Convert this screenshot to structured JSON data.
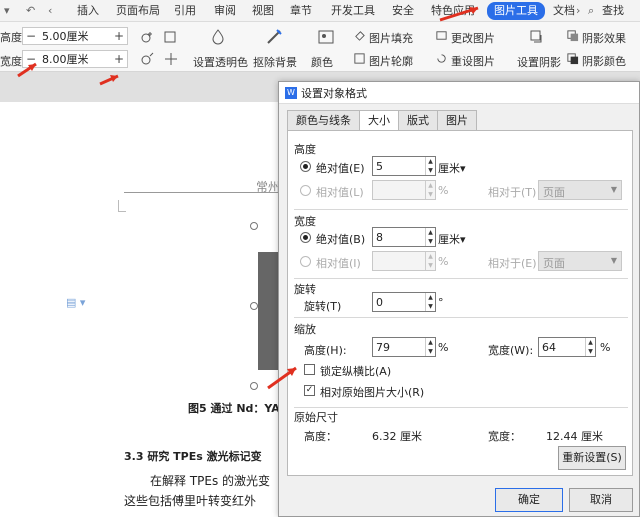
{
  "tabs": [
    {
      "label": "插入"
    },
    {
      "label": "页面布局"
    },
    {
      "label": "引用"
    },
    {
      "label": "审阅"
    },
    {
      "label": "视图"
    },
    {
      "label": "章节"
    },
    {
      "label": "开发工具"
    },
    {
      "label": "安全"
    },
    {
      "label": "特色应用"
    },
    {
      "label": "图片工具"
    },
    {
      "label": "文档"
    }
  ],
  "search_label": "查找",
  "ribbon": {
    "height_label": "高度:",
    "width_label": "宽度:",
    "height_value": "5.00厘米",
    "width_value": "8.00厘米",
    "minus": "−",
    "plus": "+",
    "transparent": "设置透明色",
    "remove_bg": "抠除背景",
    "recolor": "颜色",
    "fill": "图片填充",
    "outline": "图片轮廓",
    "change_pic": "更改图片",
    "reset_pic": "重设图片",
    "shadow": "设置阴影",
    "shadow_effect": "阴影效果",
    "shadow_color": "阴影颜色"
  },
  "document": {
    "header_text": "常州",
    "caption": "图5 通过 Nd：YA",
    "heading": "3.3 研究 TPEs 激光标记变",
    "para1": "在解释 TPEs 的激光变",
    "para2": "这些包括傅里叶转变红外"
  },
  "dialog": {
    "title": "设置对象格式",
    "tabs": [
      {
        "label": "颜色与线条"
      },
      {
        "label": "大小"
      },
      {
        "label": "版式"
      },
      {
        "label": "图片"
      }
    ],
    "height_section": "高度",
    "absolute_h": "绝对值(E)",
    "absolute_h_value": "5",
    "unit_cm": "厘米",
    "relative_h": "相对值(L)",
    "percent": "%",
    "relative_to_h": "相对于(T)",
    "page": "页面",
    "width_section": "宽度",
    "absolute_w": "绝对值(B)",
    "absolute_w_value": "8",
    "relative_w": "相对值(I)",
    "relative_to_w": "相对于(E)",
    "rotate_section": "旋转",
    "rotate_label": "旋转(T)",
    "rotate_value": "0",
    "degree": "°",
    "scale_section": "缩放",
    "scale_h_label": "高度(H):",
    "scale_h_value": "79",
    "scale_w_label": "宽度(W):",
    "scale_w_value": "64",
    "lock_ratio": "锁定纵横比(A)",
    "lock_ratio_checked": false,
    "relative_original": "相对原始图片大小(R)",
    "relative_original_checked": true,
    "original_section": "原始尺寸",
    "orig_h_label": "高度：",
    "orig_h_value": "6.32 厘米",
    "orig_w_label": "宽度：",
    "orig_w_value": "12.44 厘米",
    "reset_button": "重新设置(S)",
    "ok_button": "确定",
    "cancel_button": "取消"
  },
  "colors": {
    "accent": "#2b6ee8",
    "arrow": "#e03020"
  }
}
